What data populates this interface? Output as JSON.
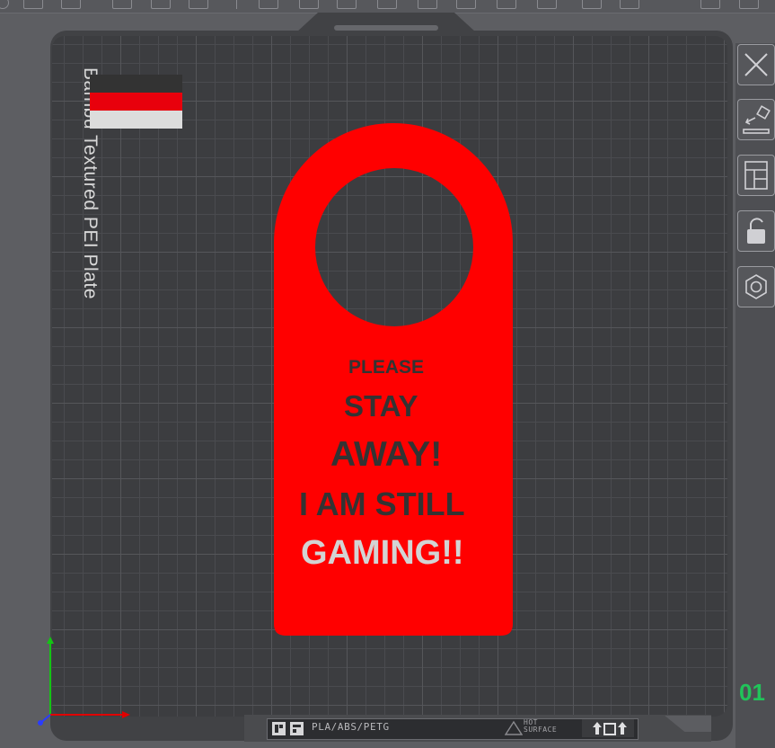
{
  "plate": {
    "label": "Bambu Textured PEI Plate",
    "number": "01",
    "material": "PLA/ABS/PETG",
    "hot_line1": "HOT",
    "hot_line2": "SURFACE"
  },
  "sign": {
    "line1": "PLEASE",
    "line2": "STAY",
    "line3": "AWAY!",
    "line4": "I AM STILL",
    "line5": "GAMING!!"
  },
  "colors": {
    "sign_red": "#ff0000",
    "text_dark": "#333333",
    "text_light": "#d3d3d3",
    "plate_number": "#21c45a"
  },
  "filament_swatches": [
    "#333333",
    "#e8000c",
    "#dcdcdc"
  ],
  "side_toolbar": [
    {
      "name": "close-icon"
    },
    {
      "name": "auto-orient-icon"
    },
    {
      "name": "arrange-icon"
    },
    {
      "name": "lock-icon"
    },
    {
      "name": "plate-settings-icon"
    }
  ]
}
